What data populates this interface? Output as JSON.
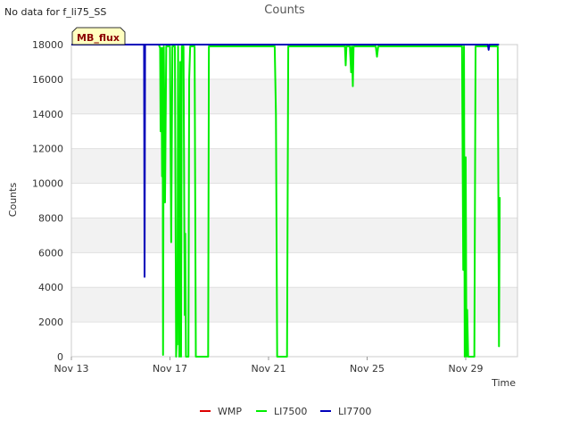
{
  "corner_note": "No data for f_li75_SS",
  "chart_data": {
    "type": "line",
    "title": "Counts",
    "xlabel": "Time",
    "ylabel": "Counts",
    "badge": "MB_flux",
    "xlim": [
      0,
      18.1
    ],
    "ylim": [
      0,
      18000
    ],
    "x_ticks": [
      {
        "value": 0,
        "label": "Nov 13"
      },
      {
        "value": 4,
        "label": "Nov 17"
      },
      {
        "value": 8,
        "label": "Nov 21"
      },
      {
        "value": 12,
        "label": "Nov 25"
      },
      {
        "value": 16,
        "label": "Nov 29"
      }
    ],
    "y_ticks": [
      0,
      2000,
      4000,
      6000,
      8000,
      10000,
      12000,
      14000,
      16000,
      18000
    ],
    "y_tick_labels": [
      "0",
      "2000",
      "4000",
      "6000",
      "8000",
      "10000",
      "12000",
      "14000",
      "16000",
      "18000"
    ],
    "grid": "horizontal bands",
    "legend_position": "bottom",
    "colors": {
      "WMP": "#dd0000",
      "LI7500": "#00ee00",
      "LI7700": "#0000bb",
      "band": "#f2f2f2",
      "badge_bg": "#ffffc0",
      "badge_text": "#8b0000"
    },
    "series": [
      {
        "name": "WMP",
        "points": []
      },
      {
        "name": "LI7500",
        "points": [
          [
            0,
            18000
          ],
          [
            3.55,
            18000
          ],
          [
            3.6,
            17800
          ],
          [
            3.62,
            13000
          ],
          [
            3.65,
            17800
          ],
          [
            3.68,
            10400
          ],
          [
            3.7,
            17800
          ],
          [
            3.72,
            100
          ],
          [
            3.75,
            17900
          ],
          [
            3.8,
            8900
          ],
          [
            3.85,
            17900
          ],
          [
            4.0,
            17900
          ],
          [
            4.05,
            6600
          ],
          [
            4.1,
            17900
          ],
          [
            4.2,
            17900
          ],
          [
            4.25,
            0
          ],
          [
            4.27,
            800
          ],
          [
            4.3,
            700
          ],
          [
            4.33,
            17900
          ],
          [
            4.38,
            0
          ],
          [
            4.42,
            17000
          ],
          [
            4.45,
            0
          ],
          [
            4.48,
            17900
          ],
          [
            4.55,
            17900
          ],
          [
            4.6,
            2400
          ],
          [
            4.62,
            7100
          ],
          [
            4.65,
            0
          ],
          [
            4.75,
            0
          ],
          [
            4.78,
            16000
          ],
          [
            4.82,
            17900
          ],
          [
            5.0,
            17900
          ],
          [
            5.05,
            0
          ],
          [
            5.55,
            0
          ],
          [
            5.58,
            17900
          ],
          [
            8.25,
            17900
          ],
          [
            8.3,
            14000
          ],
          [
            8.35,
            0
          ],
          [
            8.75,
            0
          ],
          [
            8.8,
            17900
          ],
          [
            11.1,
            17900
          ],
          [
            11.13,
            16800
          ],
          [
            11.16,
            17900
          ],
          [
            11.3,
            17900
          ],
          [
            11.35,
            16400
          ],
          [
            11.38,
            17900
          ],
          [
            11.42,
            15600
          ],
          [
            11.45,
            17900
          ],
          [
            12.35,
            17900
          ],
          [
            12.4,
            17300
          ],
          [
            12.45,
            17900
          ],
          [
            15.85,
            17900
          ],
          [
            15.9,
            5000
          ],
          [
            15.93,
            17900
          ],
          [
            15.96,
            0
          ],
          [
            16.0,
            11500
          ],
          [
            16.03,
            0
          ],
          [
            16.06,
            2700
          ],
          [
            16.1,
            0
          ],
          [
            16.35,
            0
          ],
          [
            16.4,
            17900
          ],
          [
            17.3,
            17900
          ],
          [
            17.35,
            600
          ],
          [
            17.38,
            9200
          ]
        ]
      },
      {
        "name": "LI7700",
        "points": [
          [
            0,
            18000
          ],
          [
            2.95,
            18000
          ],
          [
            2.97,
            4600
          ],
          [
            2.99,
            18000
          ],
          [
            16.9,
            18000
          ],
          [
            16.93,
            17700
          ],
          [
            16.96,
            18000
          ],
          [
            17.35,
            18000
          ]
        ]
      }
    ]
  }
}
